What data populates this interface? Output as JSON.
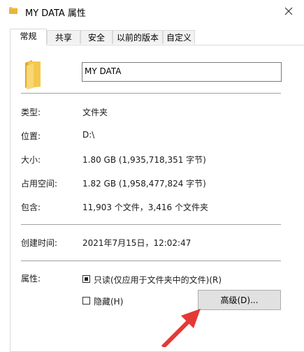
{
  "window": {
    "title": "MY DATA 属性",
    "close_icon": "close-icon",
    "folder_icon": "folder-icon"
  },
  "tabs": [
    {
      "label": "常规",
      "active": true
    },
    {
      "label": "共享",
      "active": false
    },
    {
      "label": "安全",
      "active": false
    },
    {
      "label": "以前的版本",
      "active": false
    },
    {
      "label": "自定义",
      "active": false
    }
  ],
  "general": {
    "name_value": "MY DATA",
    "rows": [
      {
        "label": "类型:",
        "value": "文件夹"
      },
      {
        "label": "位置:",
        "value": "D:\\"
      },
      {
        "label": "大小:",
        "value": "1.80 GB (1,935,718,351 字节)"
      },
      {
        "label": "占用空间:",
        "value": "1.82 GB (1,958,477,824 字节)"
      },
      {
        "label": "包含:",
        "value": "11,903 个文件，3,416 个文件夹"
      },
      {
        "label": "创建时间:",
        "value": "2021年7月15日，12:02:47"
      }
    ],
    "attributes_label": "属性:",
    "readonly_label": "只读(仅应用于文件夹中的文件)(R)",
    "readonly_state": "indeterminate",
    "hidden_label": "隐藏(H)",
    "hidden_checked": false,
    "advanced_button": "高级(D)..."
  },
  "colors": {
    "folder_yellow": "#f5c84c",
    "folder_shade": "#e0a830",
    "annotation_arrow": "#e53935"
  }
}
